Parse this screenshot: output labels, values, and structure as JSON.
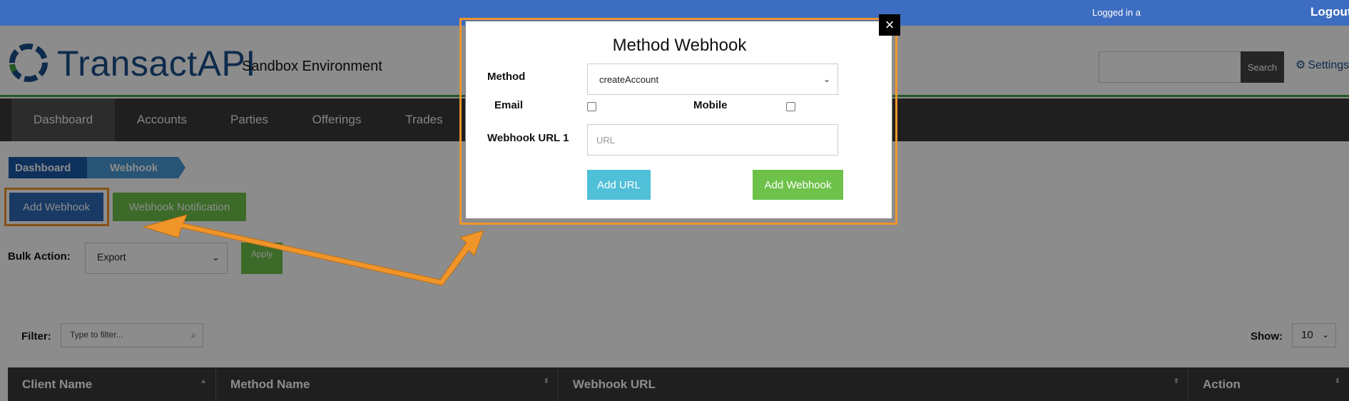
{
  "topbar": {
    "logged_in": "Logged in a",
    "logout": "Logout"
  },
  "header": {
    "brand_transact": "Transact",
    "brand_api": "API",
    "environment": "Sandbox Environment",
    "search_button": "Search",
    "settings": "Settings"
  },
  "nav": {
    "items": [
      "Dashboard",
      "Accounts",
      "Parties",
      "Offerings",
      "Trades"
    ],
    "active": "Dashboard"
  },
  "breadcrumb": [
    "Dashboard",
    "Webhook"
  ],
  "actions": {
    "add_webhook": "Add Webhook",
    "webhook_notification": "Webhook Notification"
  },
  "bulk": {
    "label": "Bulk Action:",
    "selected": "Export",
    "apply": "Apply"
  },
  "filter": {
    "label": "Filter:",
    "placeholder": "Type to filter..."
  },
  "show": {
    "label": "Show:",
    "selected": "10"
  },
  "table": {
    "headers": [
      "Client Name",
      "Method Name",
      "Webhook URL",
      "Action"
    ]
  },
  "modal": {
    "title": "Method Webhook",
    "close": "×",
    "method_label": "Method",
    "method_selected": "createAccount",
    "email_label": "Email",
    "mobile_label": "Mobile",
    "webhook_url_label": "Webhook URL 1",
    "url_placeholder": "URL",
    "add_url": "Add URL",
    "add_webhook": "Add Webhook"
  },
  "colors": {
    "topbar": "#3d6dc0",
    "nav": "#3a3a3a",
    "primary_blue": "#2f6ab6",
    "green": "#6ec24a",
    "cyan": "#4fc0d8",
    "highlight_orange": "#f0952a"
  }
}
